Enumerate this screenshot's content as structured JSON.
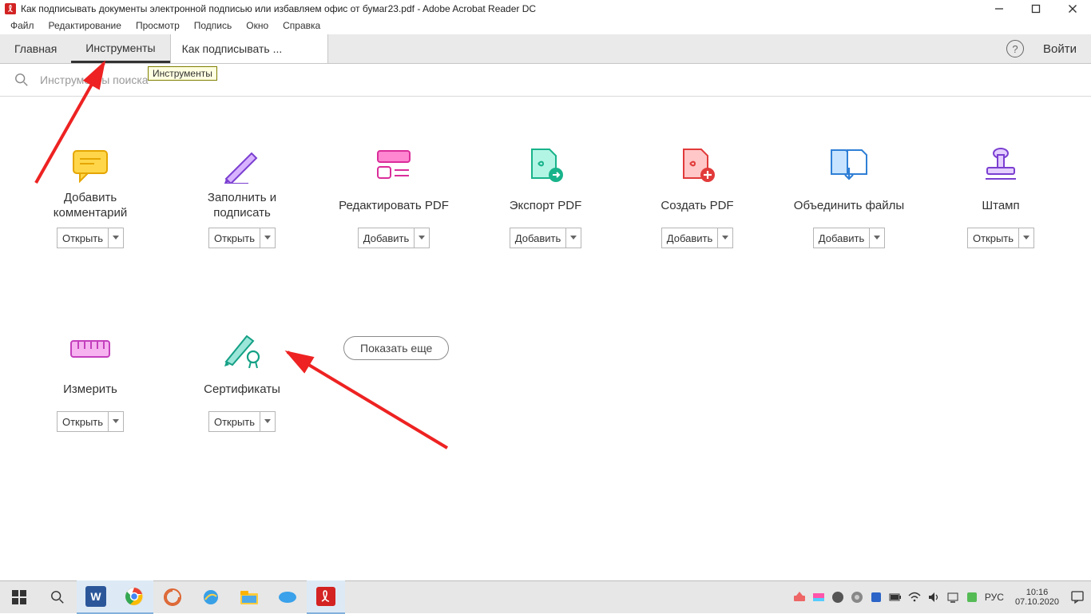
{
  "window": {
    "title": "Как подписывать документы электронной подписью или избавляем офис от бумаг23.pdf - Adobe Acrobat Reader DC"
  },
  "menu": {
    "items": [
      "Файл",
      "Редактирование",
      "Просмотр",
      "Подпись",
      "Окно",
      "Справка"
    ]
  },
  "tabs": {
    "home": "Главная",
    "tools": "Инструменты",
    "doc": "Как подписывать ...",
    "help": "?",
    "signin": "Войти"
  },
  "search": {
    "placeholder": "Инструменты поиска"
  },
  "tooltip": "Инструменты",
  "btn": {
    "open": "Открыть",
    "add": "Добавить"
  },
  "tools": {
    "comment": "Добавить\nкомментарий",
    "fillsign": "Заполнить и\nподписать",
    "editpdf": "Редактировать PDF",
    "exportpdf": "Экспорт PDF",
    "createpdf": "Создать PDF",
    "combine": "Объединить файлы",
    "stamp": "Штамп",
    "measure": "Измерить",
    "certs": "Сертификаты"
  },
  "showmore": "Показать еще",
  "taskbar": {
    "lang": "РУС",
    "time": "10:16",
    "date": "07.10.2020"
  }
}
